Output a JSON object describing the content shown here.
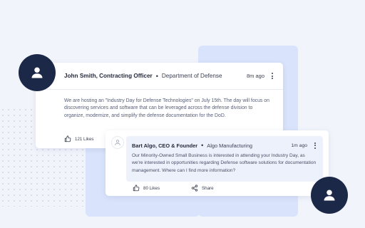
{
  "post": {
    "author": "John Smith, Contracting Officer",
    "separator": "•",
    "org": "Department of Defense",
    "time": "8m ago",
    "body": "We are hosting an \"Industry Day for Defense Technologies\" on July 15th. The day will focus on discovering services and software that can be leveraged across the defense division to organize, modernize, and simplify the defense documentation for the DoD.",
    "likes": "121 Likes"
  },
  "reply": {
    "author": "Bart Algo, CEO & Founder",
    "separator": "•",
    "org": "Algo Manufacturing",
    "time": "1m ago",
    "body": "Our Minority-Owned Small Business is interested in attending your Industry Day, as we're interested in opportunities regarding Defense software solutions for documentation management. Where can I find more information?",
    "likes": "80 Likes",
    "share": "Share"
  },
  "icons": {
    "avatar": "user-icon",
    "like": "thumbs-up-icon",
    "share": "share-icon",
    "menu": "kebab-menu-icon"
  },
  "colors": {
    "background": "#f1f4fb",
    "panel": "#d9e3fb",
    "avatar": "#1c2847",
    "reply_bubble": "#edf1fb"
  }
}
